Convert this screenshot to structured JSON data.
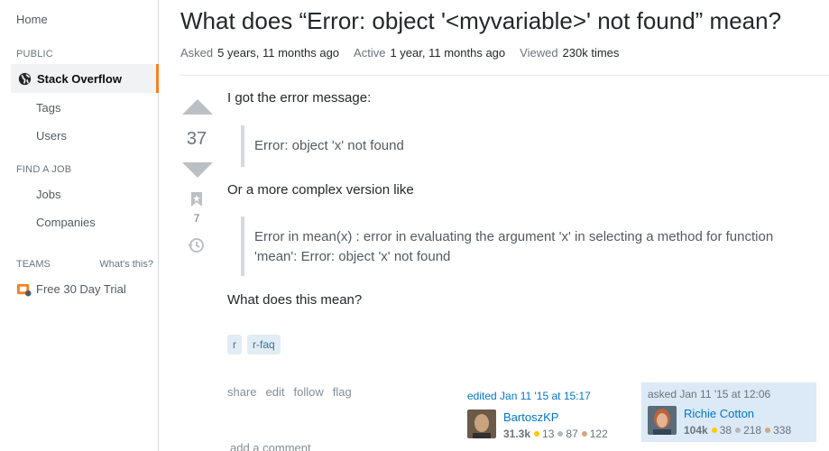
{
  "sidebar": {
    "home": "Home",
    "public_label": "PUBLIC",
    "active_item": "Stack Overflow",
    "tags": "Tags",
    "users": "Users",
    "find_job_label": "FIND A JOB",
    "jobs": "Jobs",
    "companies": "Companies",
    "teams_label": "TEAMS",
    "whats_this": "What's this?",
    "trial": "Free 30 Day Trial"
  },
  "question": {
    "title": "What does “Error: object '<myvariable>' not found” mean?",
    "asked_label": "Asked",
    "asked_value": "5 years, 11 months ago",
    "active_label": "Active",
    "active_value": "1 year, 11 months ago",
    "viewed_label": "Viewed",
    "viewed_value": "230k times",
    "votes": "37",
    "bookmarks": "7",
    "body": {
      "p1": "I got the error message:",
      "quote1": "Error: object 'x' not found",
      "p2": "Or a more complex version like",
      "quote2_line1": "Error in mean(x) : error in evaluating the argument 'x' in selecting a method for function",
      "quote2_line2": "'mean': Error: object 'x' not found",
      "p3": "What does this mean?"
    },
    "tags": [
      "r",
      "r-faq"
    ],
    "actions": [
      "share",
      "edit",
      "follow",
      "flag"
    ],
    "add_comment": "add a comment"
  },
  "edited_card": {
    "when": "edited Jan 11 '15 at 15:17",
    "name": "BartoszKP",
    "rep": "31.3k",
    "gold": "13",
    "silver": "87",
    "bronze": "122"
  },
  "asked_card": {
    "when": "asked Jan 11 '15 at 12:06",
    "name": "Richie Cotton",
    "rep": "104k",
    "gold": "38",
    "silver": "218",
    "bronze": "338"
  },
  "colors": {
    "accent": "#f48024",
    "link": "#0077cc",
    "tag_bg": "#e1ecf4",
    "tag_text": "#39739d"
  }
}
